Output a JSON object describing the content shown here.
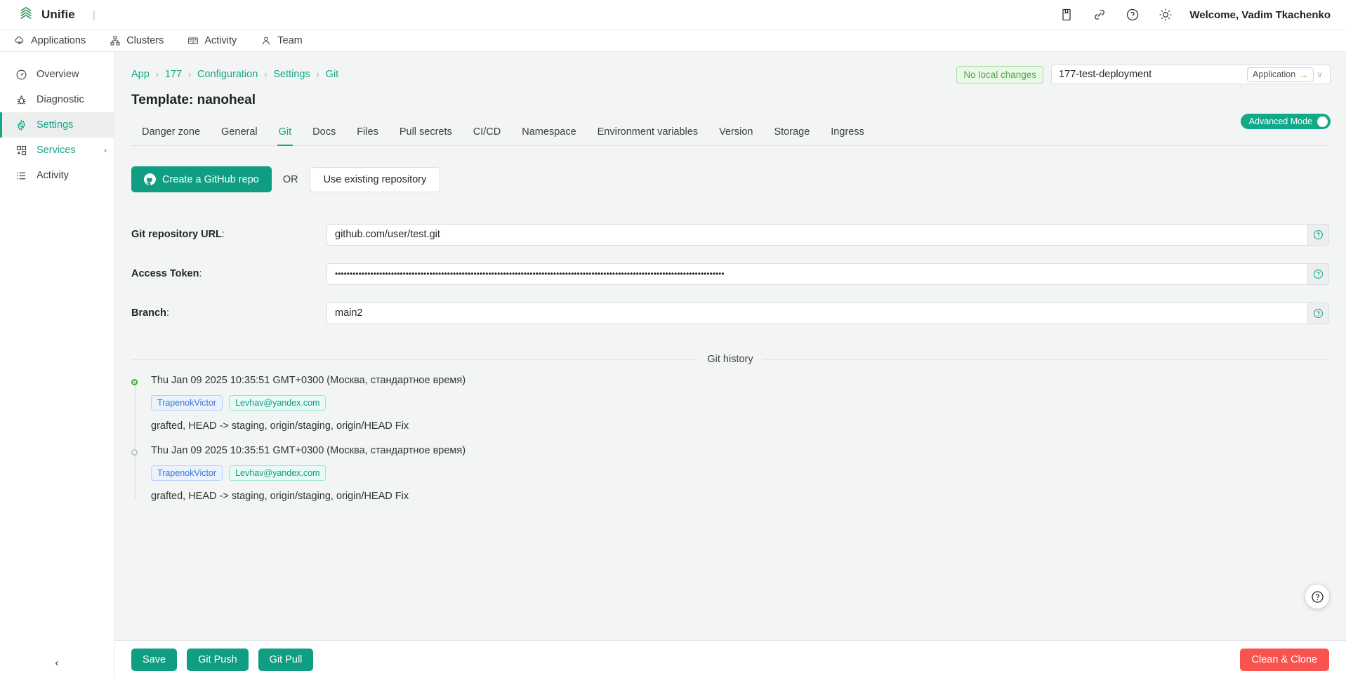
{
  "topbar": {
    "brand": "Unifie",
    "brand_separator": "|",
    "icons": [
      {
        "name": "book-icon"
      },
      {
        "name": "link-icon"
      },
      {
        "name": "help-circle-icon"
      },
      {
        "name": "sun-icon"
      }
    ],
    "welcome": "Welcome, Vadim Tkachenko"
  },
  "navbar": {
    "items": [
      {
        "label": "Applications",
        "icon": "cloud-app-icon"
      },
      {
        "label": "Clusters",
        "icon": "cluster-icon"
      },
      {
        "label": "Activity",
        "icon": "book-open-icon"
      },
      {
        "label": "Team",
        "icon": "user-icon"
      }
    ]
  },
  "sidebar": {
    "items": [
      {
        "label": "Overview",
        "icon": "gauge-icon",
        "active": false,
        "teal": false,
        "chevron": ""
      },
      {
        "label": "Diagnostic",
        "icon": "bug-icon",
        "active": false,
        "teal": false,
        "chevron": ""
      },
      {
        "label": "Settings",
        "icon": "gear-icon",
        "active": true,
        "teal": false,
        "chevron": ""
      },
      {
        "label": "Services",
        "icon": "services-grid-icon",
        "active": false,
        "teal": true,
        "chevron": "›"
      },
      {
        "label": "Activity",
        "icon": "list-icon",
        "active": false,
        "teal": false,
        "chevron": ""
      }
    ],
    "collapse_glyph": "‹"
  },
  "breadcrumb": {
    "items": [
      "App",
      "177",
      "Configuration",
      "Settings",
      "Git"
    ],
    "separator": "›"
  },
  "header_right": {
    "status_badge": "No local changes",
    "status_badge_color": "#4aa83d",
    "deployment_value": "177-test-deployment",
    "scope_pill": "Application",
    "scope_pill_arrow": "→",
    "scope_pill_arrow_color": "#f08a24",
    "dropdown_chevron": "∨"
  },
  "page": {
    "title": "Template: nanoheal",
    "accent_color": "#12a88a"
  },
  "tabs": {
    "active": "Git",
    "items": [
      {
        "label": "Danger zone"
      },
      {
        "label": "General"
      },
      {
        "label": "Git"
      },
      {
        "label": "Docs"
      },
      {
        "label": "Files"
      },
      {
        "label": "Pull secrets"
      },
      {
        "label": "CI/CD"
      },
      {
        "label": "Namespace"
      },
      {
        "label": "Environment variables"
      },
      {
        "label": "Version"
      },
      {
        "label": "Storage"
      },
      {
        "label": "Ingress"
      }
    ],
    "advanced_mode_label": "Advanced Mode",
    "advanced_mode_on": true
  },
  "actions": {
    "create_repo_label": "Create a GitHub repo",
    "or_label": "OR",
    "use_existing_label": "Use existing repository"
  },
  "form": {
    "colon": ":",
    "fields": [
      {
        "label": "Git repository URL",
        "value": "github.com/user/test.git",
        "placeholder": "github.com/user/test.git",
        "masked": false
      },
      {
        "label": "Access Token",
        "value": "••••••••••••••••••••••••••••••••••••••••••••••••••••••••••••••••••••••••••••••••••••••••••••••••••••••••••••••••••••••••••••••••••••",
        "placeholder": "",
        "masked": true
      },
      {
        "label": "Branch",
        "value": "main2",
        "placeholder": "main",
        "masked": false
      }
    ]
  },
  "git_history": {
    "section_label": "Git history",
    "commits": [
      {
        "date": "Thu Jan 09 2025 10:35:51 GMT+0300 (Москва, стандартное время)",
        "author": "TrapenokVictor",
        "email": "Levhav@yandex.com",
        "message": "grafted, HEAD -> staging, origin/staging, origin/HEAD Fix",
        "dot": "green"
      },
      {
        "date": "Thu Jan 09 2025 10:35:51 GMT+0300 (Москва, стандартное время)",
        "author": "TrapenokVictor",
        "email": "Levhav@yandex.com",
        "message": "grafted, HEAD -> staging, origin/staging, origin/HEAD Fix",
        "dot": "gray"
      }
    ]
  },
  "footer": {
    "save_label": "Save",
    "git_push_label": "Git Push",
    "git_pull_label": "Git Pull",
    "clean_clone_label": "Clean & Clone",
    "danger_color": "#f9534f"
  }
}
